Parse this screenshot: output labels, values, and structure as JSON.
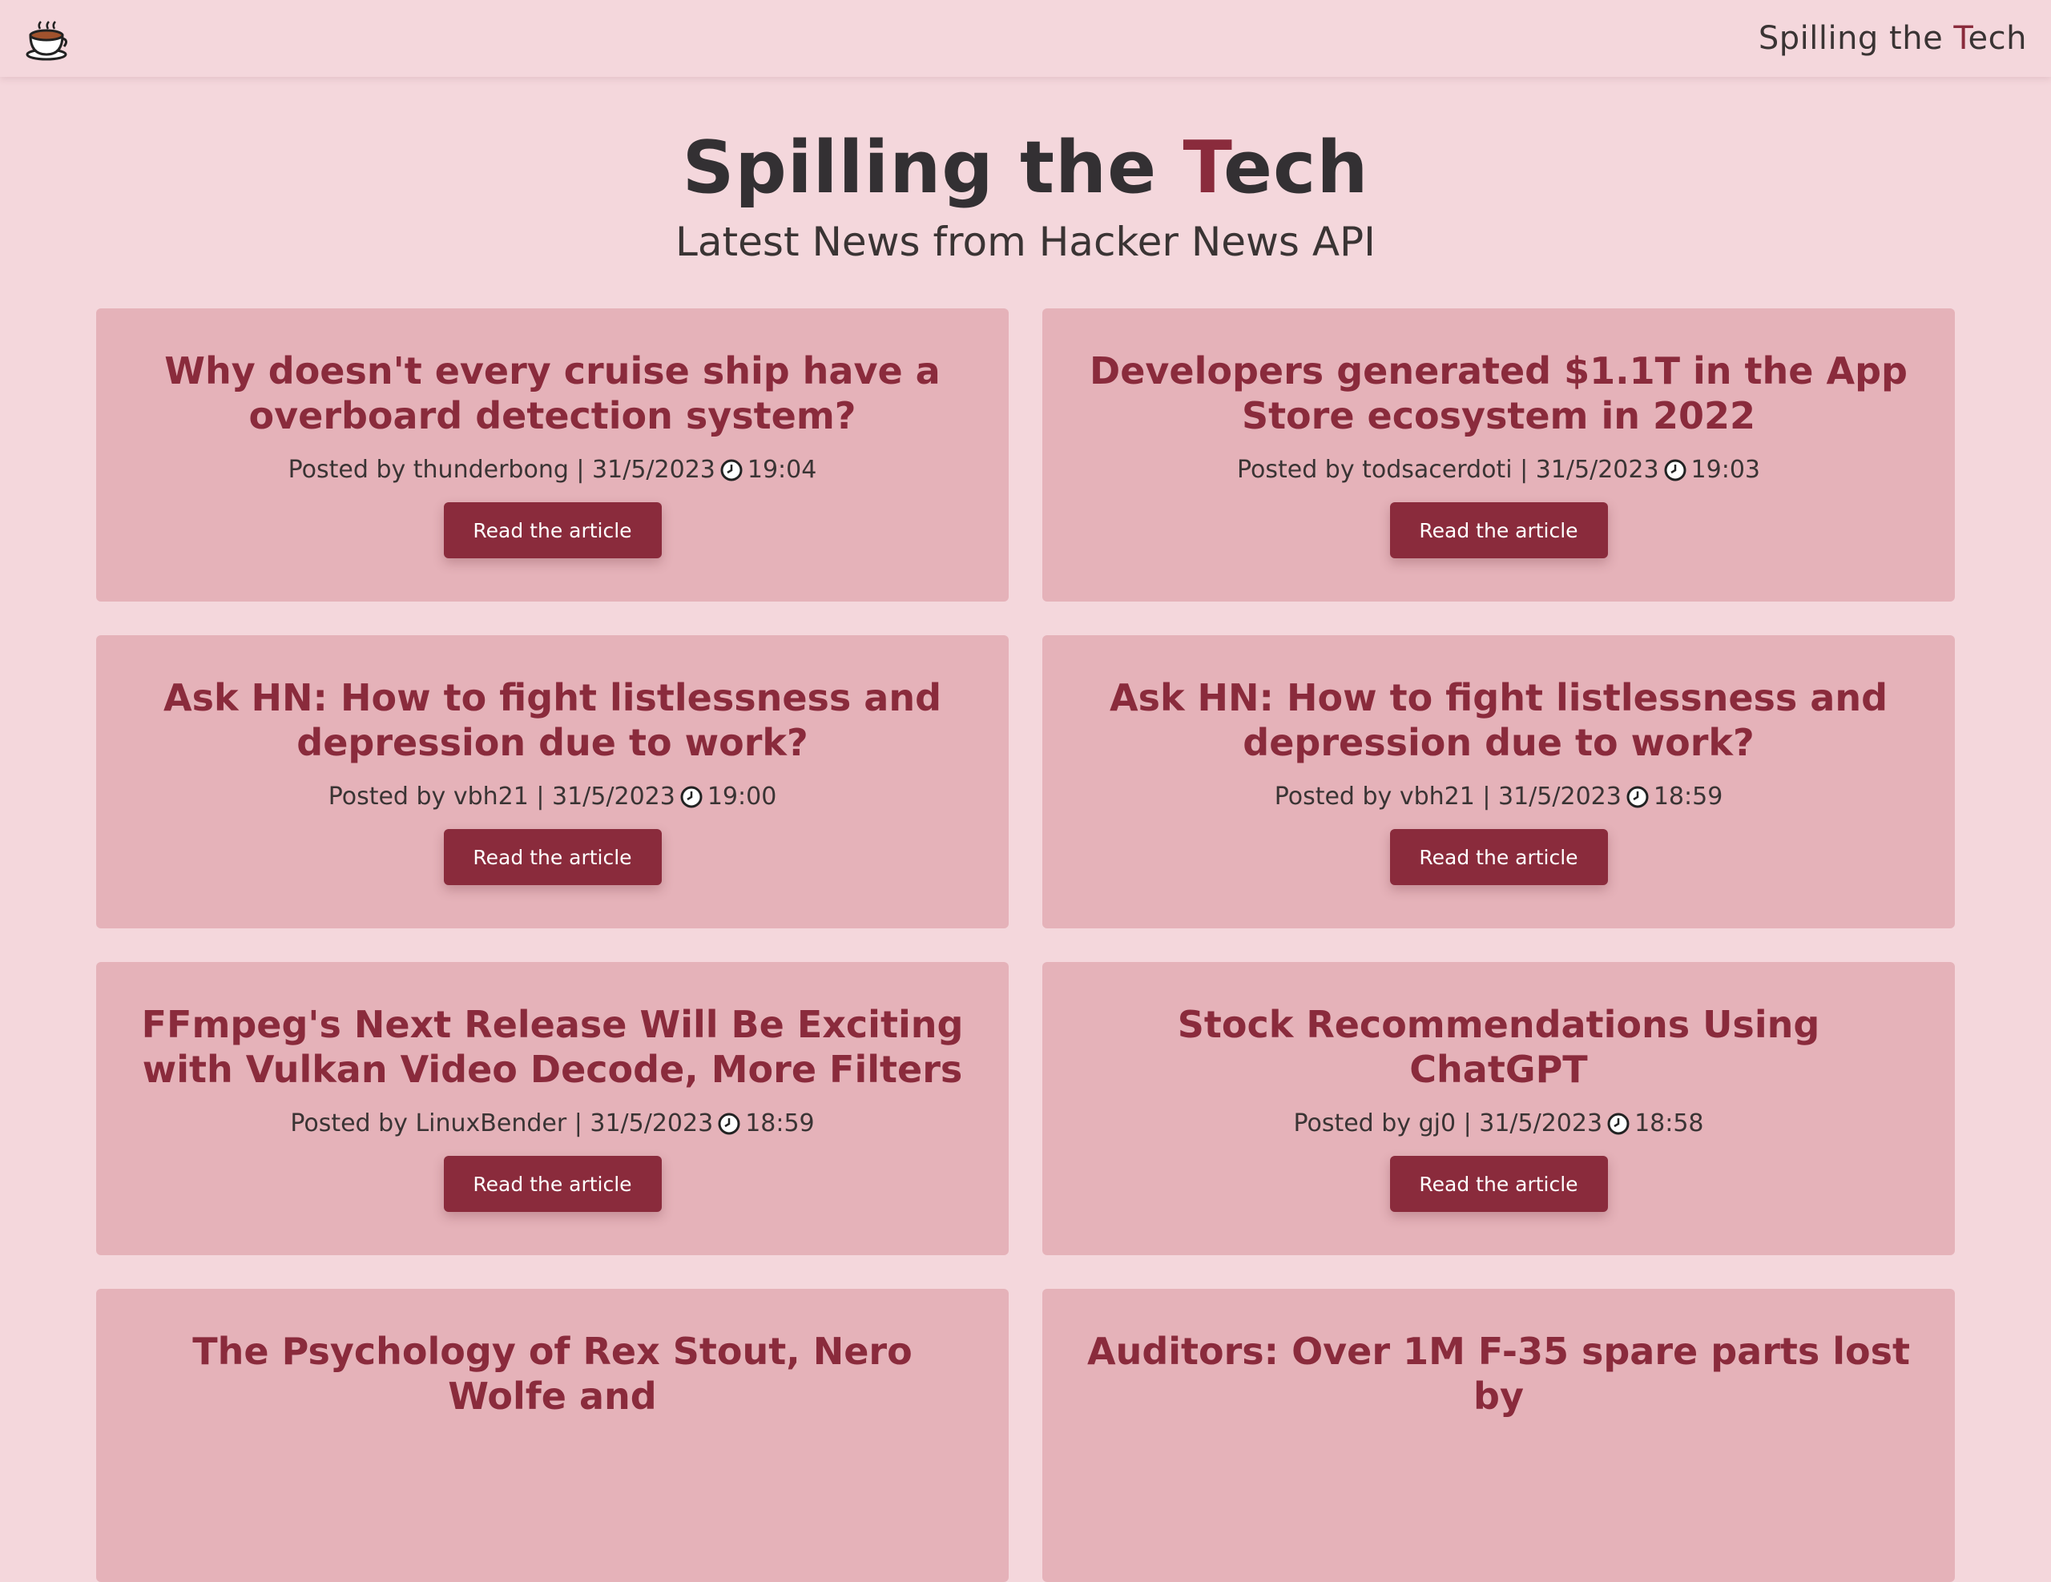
{
  "navbar": {
    "logo_icon": "teacup-icon",
    "brand_prefix": "Spilling the ",
    "brand_accent": "T",
    "brand_suffix": "ech"
  },
  "hero": {
    "title_prefix": "Spilling the ",
    "title_accent": "T",
    "title_suffix": "ech",
    "subtitle": "Latest News from Hacker News API"
  },
  "colors": {
    "background": "#f4d7dc",
    "card": "#e5b2b9",
    "accent": "#8a2b3c",
    "text": "#333033"
  },
  "articles": [
    {
      "title": "Why doesn't every cruise ship have a overboard detection system?",
      "meta_prefix": "Posted by thunderbong | 31/5/2023",
      "time": "19:04",
      "button_label": "Read the article"
    },
    {
      "title": "Developers generated $1.1T in the App Store ecosystem in 2022",
      "meta_prefix": "Posted by todsacerdoti | 31/5/2023",
      "time": "19:03",
      "button_label": "Read the article"
    },
    {
      "title": "Ask HN: How to fight listlessness and depression due to work?",
      "meta_prefix": "Posted by vbh21 | 31/5/2023",
      "time": "19:00",
      "button_label": "Read the article"
    },
    {
      "title": "Ask HN: How to fight listlessness and depression due to work?",
      "meta_prefix": "Posted by vbh21 | 31/5/2023",
      "time": "18:59",
      "button_label": "Read the article"
    },
    {
      "title": "FFmpeg's Next Release Will Be Exciting with Vulkan Video Decode, More Filters",
      "meta_prefix": "Posted by LinuxBender | 31/5/2023",
      "time": "18:59",
      "button_label": "Read the article"
    },
    {
      "title": "Stock Recommendations Using ChatGPT",
      "meta_prefix": "Posted by gj0 | 31/5/2023",
      "time": "18:58",
      "button_label": "Read the article"
    },
    {
      "title": "The Psychology of Rex Stout, Nero Wolfe and",
      "meta_prefix": "",
      "time": "",
      "button_label": ""
    },
    {
      "title": "Auditors: Over 1M F-35 spare parts lost by",
      "meta_prefix": "",
      "time": "",
      "button_label": ""
    }
  ]
}
